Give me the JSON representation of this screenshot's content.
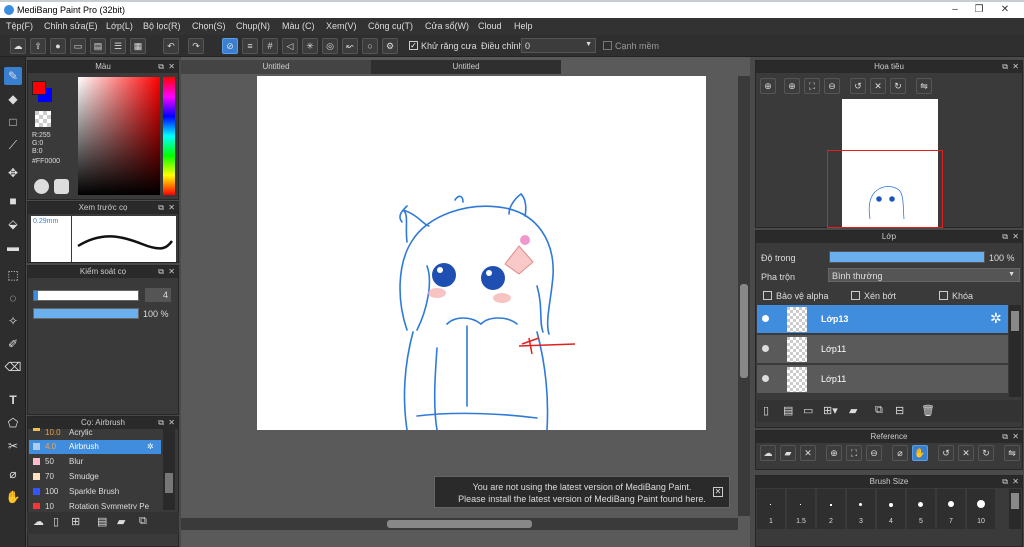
{
  "window": {
    "title": "MediBang Paint Pro (32bit)"
  },
  "menu": [
    "Tệp(F)",
    "Chỉnh sửa(E)",
    "Lớp(L)",
    "Bộ lọc(R)",
    "Chọn(S)",
    "Chụp(N)",
    "Màu (C)",
    "Xem(V)",
    "Công cụ(T)",
    "Cửa sổ(W)",
    "Cloud",
    "Help"
  ],
  "toolbar": {
    "antialias_label": "Khử răng cưa",
    "adjust_label": "Điều chỉnh",
    "adjust_value": "0",
    "smooth_label": "Cạnh mềm"
  },
  "color_panel": {
    "title": "Màu",
    "r": "R:255",
    "g": "G:0",
    "b": "B:0",
    "hex": "#FF0000",
    "primary_color": "#ff0000",
    "secondary_color": "#0000ff"
  },
  "preview_panel": {
    "title": "Xem trước cọ",
    "size": "0.29mm"
  },
  "brush_control": {
    "title": "Kiểm soát cọ",
    "size_value": "4",
    "opacity_value": "100 %"
  },
  "brush_panel": {
    "title": "Cọ: Airbrush",
    "items": [
      {
        "size": "10.0",
        "name": "Acrylic",
        "color": "#f0c14b"
      },
      {
        "size": "4.0",
        "name": "Airbrush",
        "color": "#aaccee",
        "selected": true
      },
      {
        "size": "50",
        "name": "Blur",
        "color": "#ffbbcc"
      },
      {
        "size": "70",
        "name": "Smudge",
        "color": "#ffe0c0"
      },
      {
        "size": "100",
        "name": "Sparkle Brush",
        "color": "#3355ff"
      },
      {
        "size": "10",
        "name": "Rotation Symmetry Pe",
        "color": "#ff3333"
      }
    ]
  },
  "canvas": {
    "tabs": [
      "Untitled",
      "Untitled"
    ]
  },
  "notice": {
    "line1": "You are not using the latest version of MediBang Paint.",
    "line2": "Please install the latest version of MediBang Paint found here."
  },
  "navigator": {
    "title": "Họa tiêu"
  },
  "layer_panel": {
    "title": "Lớp",
    "opacity_label": "Độ trong",
    "opacity_value": "100 %",
    "opacity_fraction": 1.0,
    "blend_label": "Pha trộn",
    "blend_value": "Bình thường",
    "protect_alpha": "Bảo vệ alpha",
    "clipping": "Xén bớt",
    "lock": "Khóa",
    "layers": [
      {
        "name": "Lớp13",
        "selected": true
      },
      {
        "name": "Lớp11"
      },
      {
        "name": "Lớp11"
      }
    ]
  },
  "reference": {
    "title": "Reference"
  },
  "brush_size": {
    "title": "Brush Size",
    "sizes": [
      "1",
      "1.5",
      "2",
      "3",
      "4",
      "5",
      "7",
      "10"
    ]
  }
}
